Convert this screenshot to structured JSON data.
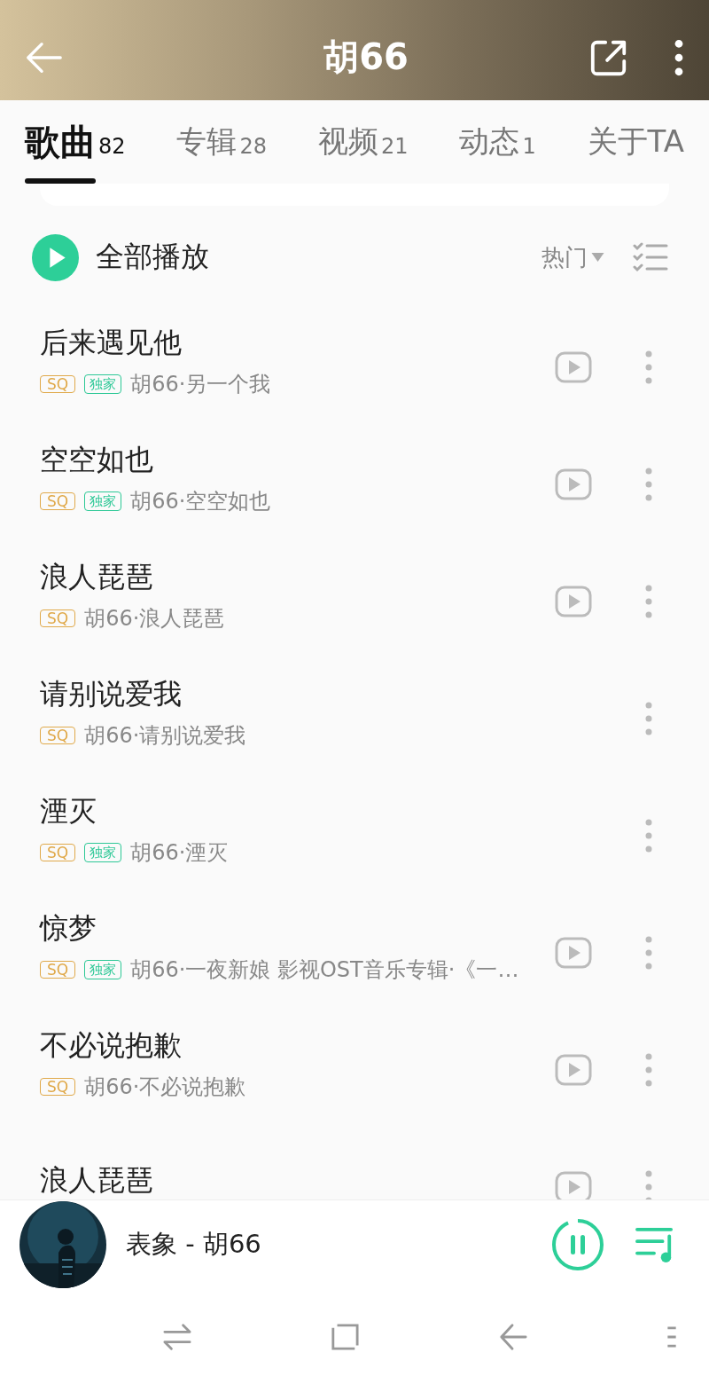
{
  "header": {
    "title": "胡66"
  },
  "tabs": [
    {
      "label": "歌曲",
      "count": "82",
      "selected": true
    },
    {
      "label": "专辑",
      "count": "28",
      "selected": false
    },
    {
      "label": "视频",
      "count": "21",
      "selected": false
    },
    {
      "label": "动态",
      "count": "1",
      "selected": false
    },
    {
      "label": "关于TA",
      "selected": false
    }
  ],
  "play_all": {
    "label": "全部播放",
    "sort": "热门"
  },
  "songs": [
    {
      "title": "后来遇见他",
      "tags": [
        {
          "kind": "sq",
          "text": "SQ"
        },
        {
          "kind": "exclusive",
          "text": "独家"
        }
      ],
      "info": "胡66·另一个我",
      "has_video": true
    },
    {
      "title": "空空如也",
      "tags": [
        {
          "kind": "sq",
          "text": "SQ"
        },
        {
          "kind": "exclusive",
          "text": "独家"
        }
      ],
      "info": "胡66·空空如也",
      "has_video": true
    },
    {
      "title": "浪人琵琶",
      "tags": [
        {
          "kind": "sq",
          "text": "SQ"
        }
      ],
      "info": "胡66·浪人琵琶",
      "has_video": true
    },
    {
      "title": "请别说爱我",
      "tags": [
        {
          "kind": "sq",
          "text": "SQ"
        }
      ],
      "info": "胡66·请别说爱我",
      "has_video": false
    },
    {
      "title": "湮灭",
      "tags": [
        {
          "kind": "sq",
          "text": "SQ"
        },
        {
          "kind": "exclusive",
          "text": "独家"
        }
      ],
      "info": "胡66·湮灭",
      "has_video": false
    },
    {
      "title": "惊梦",
      "tags": [
        {
          "kind": "sq",
          "text": "SQ"
        },
        {
          "kind": "exclusive",
          "text": "独家"
        }
      ],
      "info": "胡66·一夜新娘 影视OST音乐专辑·《一…",
      "has_video": true
    },
    {
      "title": "不必说抱歉",
      "tags": [
        {
          "kind": "sq",
          "text": "SQ"
        }
      ],
      "info": "胡66·不必说抱歉",
      "has_video": true
    },
    {
      "title": "浪人琵琶",
      "has_video": true
    }
  ],
  "player": {
    "now_playing": "表象 - 胡66",
    "level": 0.93
  }
}
